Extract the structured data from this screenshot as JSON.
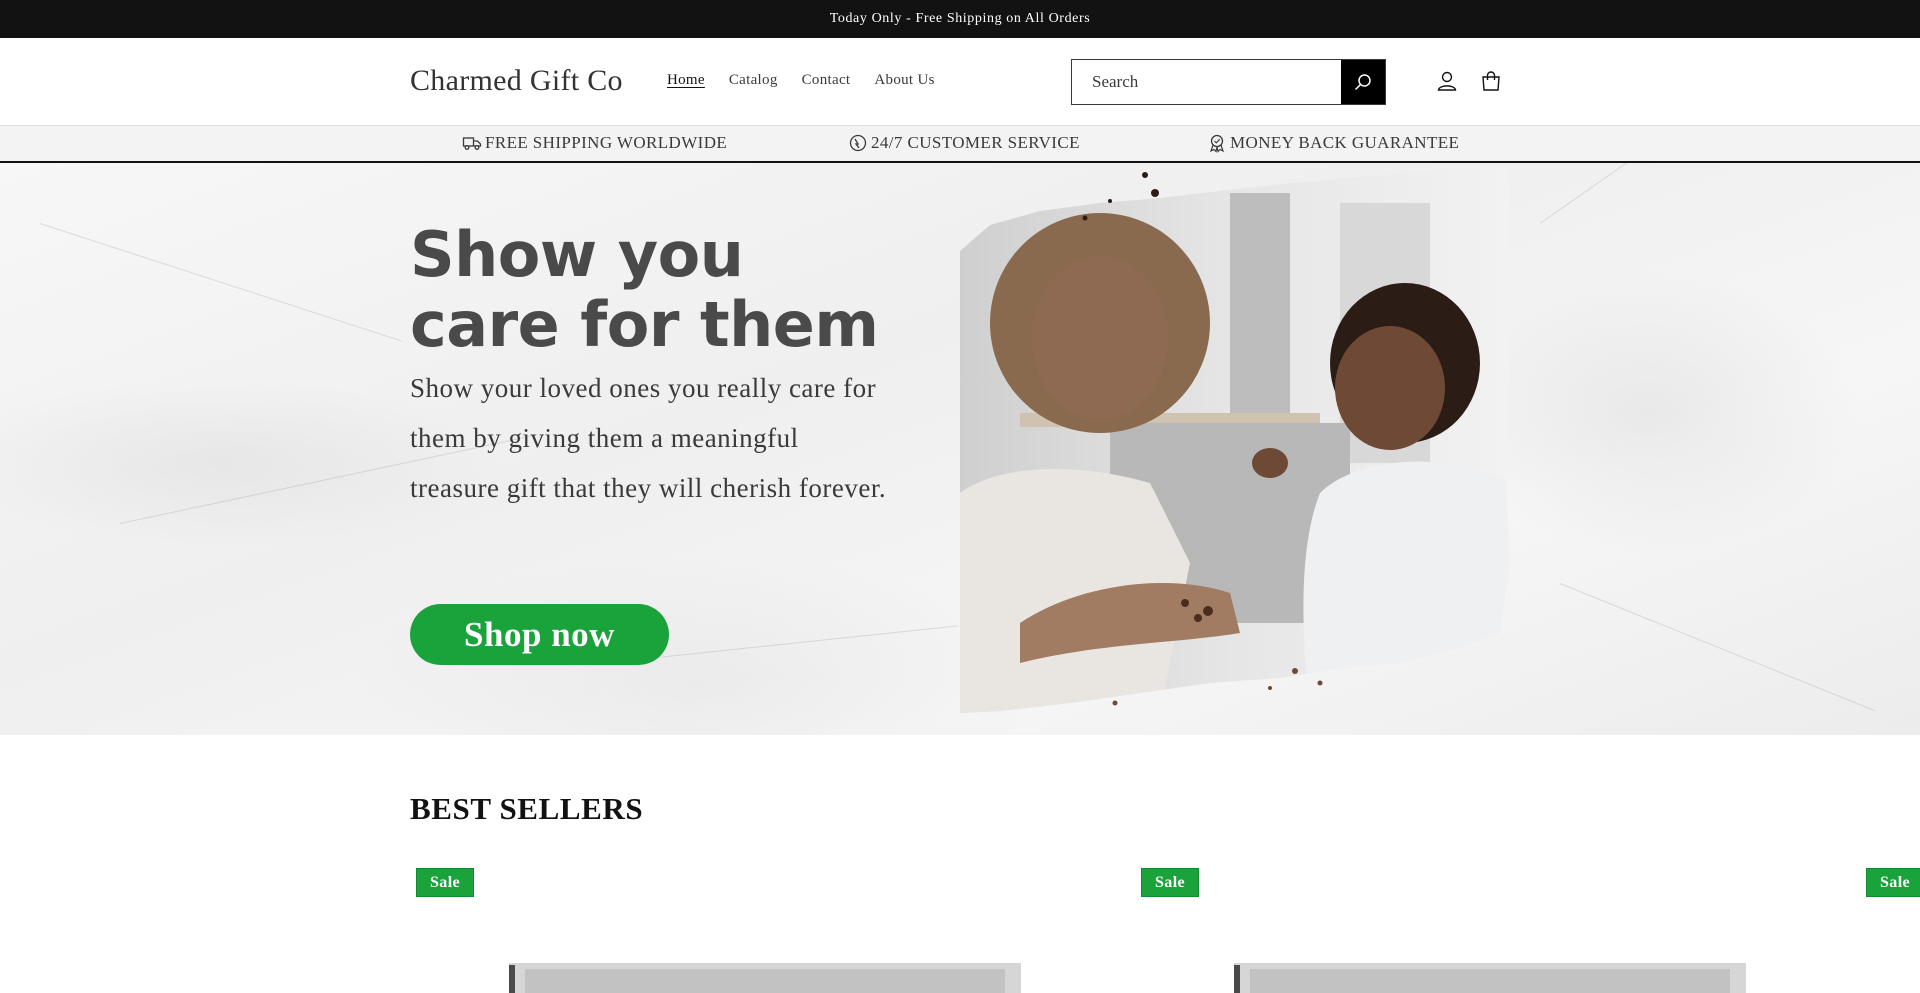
{
  "announcement": "Today Only - Free Shipping on All Orders",
  "header": {
    "logo": "Charmed Gift Co",
    "nav": [
      "Home",
      "Catalog",
      "Contact",
      "About Us"
    ],
    "active_nav": "Home",
    "search_placeholder": "Search",
    "icons": [
      "search-icon",
      "account-icon",
      "cart-icon"
    ]
  },
  "usp": [
    {
      "icon": "truck-icon",
      "label": "FREE SHIPPING WORLDWIDE"
    },
    {
      "icon": "headset-icon",
      "label": "24/7 CUSTOMER SERVICE"
    },
    {
      "icon": "badge-icon",
      "label": "MONEY BACK GUARANTEE"
    }
  ],
  "hero": {
    "title": "Show you care for them",
    "text": "Show your loved ones you really care for them by giving them a meaningful treasure gift that they will cherish forever.",
    "button": "Shop now",
    "image_alt": "Mother and daughter sharing small treats"
  },
  "best_sellers": {
    "title": "BEST SELLERS",
    "badges": [
      "Sale",
      "Sale",
      "Sale"
    ]
  },
  "colors": {
    "accent": "#1aa33b",
    "dark": "#121212",
    "hero_text": "#4a4a4a"
  }
}
